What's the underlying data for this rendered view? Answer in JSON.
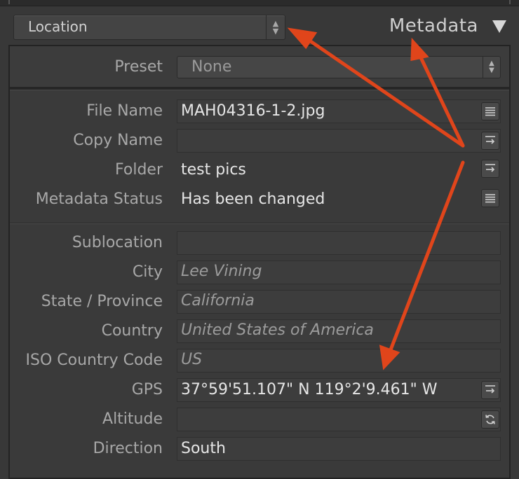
{
  "header": {
    "view_select": "Location",
    "panel_title": "Metadata"
  },
  "preset": {
    "label": "Preset",
    "value": "None"
  },
  "file_info": [
    {
      "label": "File Name",
      "value": "MAH04316-1-2.jpg",
      "button": "list-icon"
    },
    {
      "label": "Copy Name",
      "value": "",
      "button": "arrow-right-icon"
    },
    {
      "label": "Folder",
      "value": "test pics",
      "button": "arrow-right-icon"
    },
    {
      "label": "Metadata Status",
      "value": "Has been changed",
      "button": "list-icon"
    }
  ],
  "location": [
    {
      "label": "Sublocation",
      "value": "",
      "placeholder": true
    },
    {
      "label": "City",
      "value": "Lee Vining",
      "placeholder": true
    },
    {
      "label": "State / Province",
      "value": "California",
      "placeholder": true
    },
    {
      "label": "Country",
      "value": "United States of America",
      "placeholder": true
    },
    {
      "label": "ISO Country Code",
      "value": "US",
      "placeholder": true
    },
    {
      "label": "GPS",
      "value": "37°59'51.107\" N 119°2'9.461\" W",
      "button": "arrow-right-icon"
    },
    {
      "label": "Altitude",
      "value": "",
      "button": "refresh-icon"
    },
    {
      "label": "Direction",
      "value": "South"
    }
  ],
  "annotation_color": "#e0451b"
}
